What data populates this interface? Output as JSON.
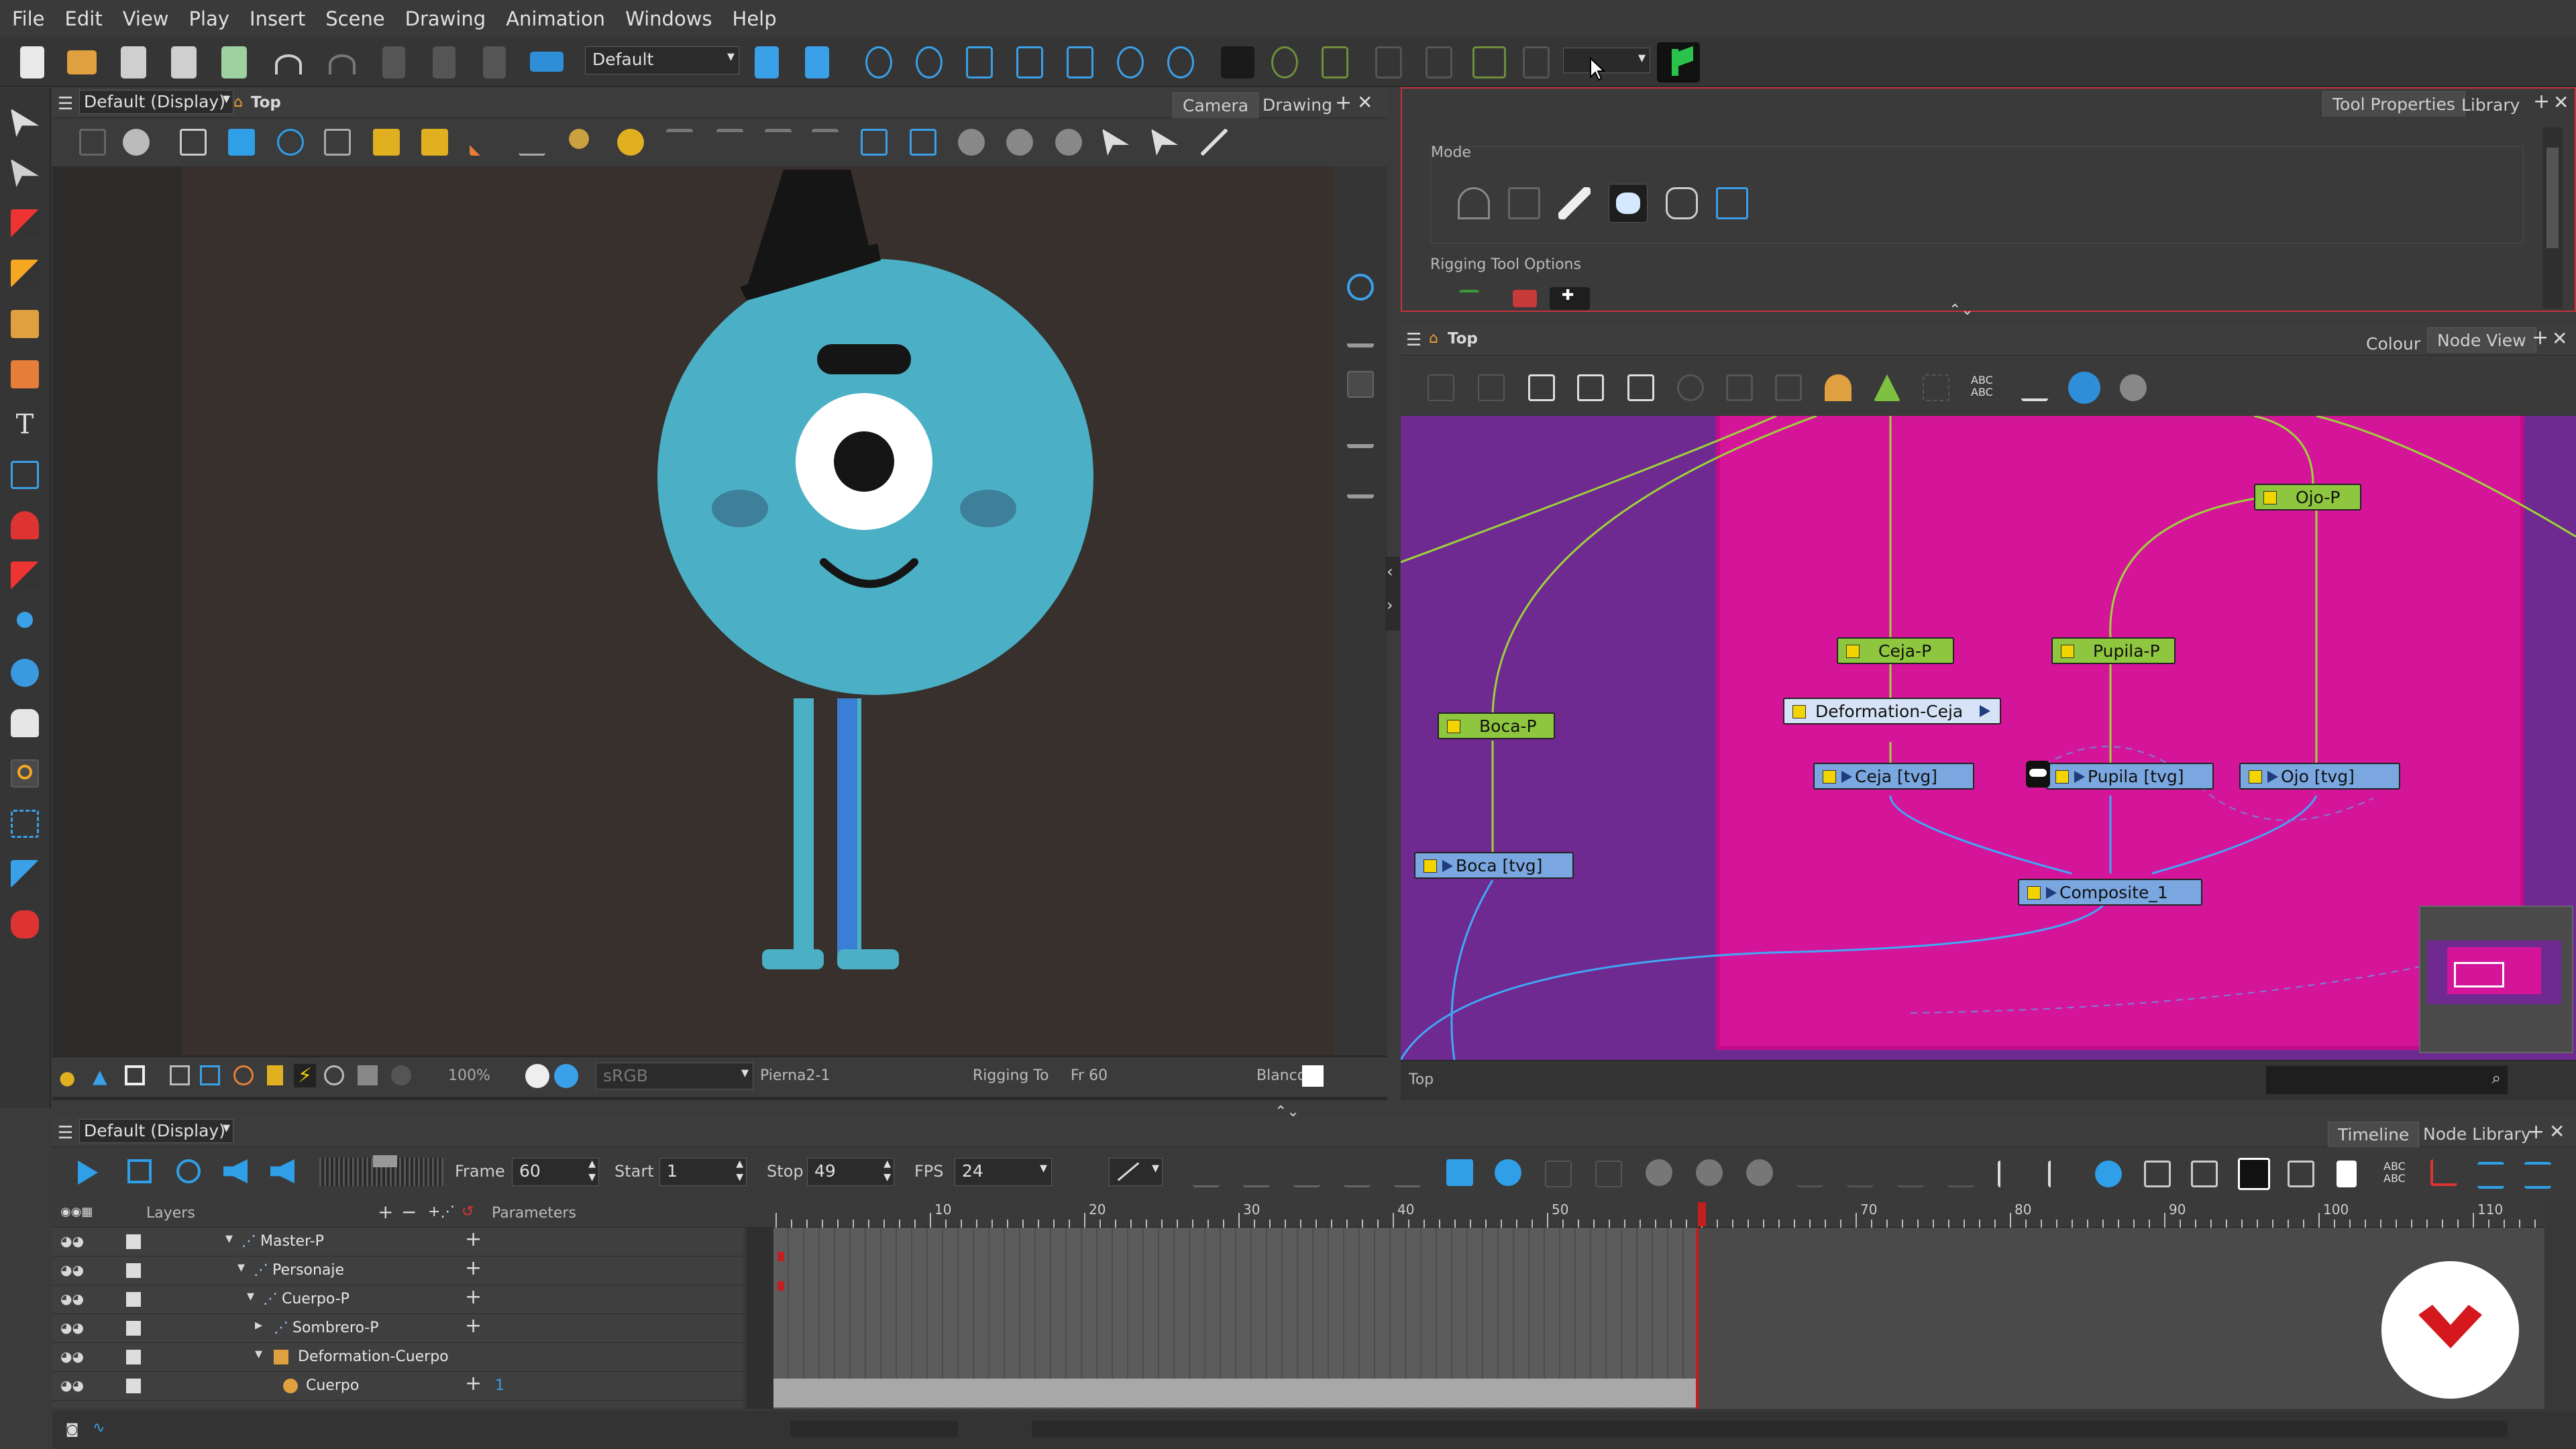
{
  "menu": [
    "File",
    "Edit",
    "View",
    "Play",
    "Insert",
    "Scene",
    "Drawing",
    "Animation",
    "Windows",
    "Help"
  ],
  "top_toolbar": {
    "workspace_value": "Default"
  },
  "camera_view": {
    "view_combo": "Default (Display)",
    "title": "Top",
    "tabs": [
      "Camera",
      "Drawing"
    ],
    "status": {
      "zoom": "100%",
      "color_space": "sRGB",
      "drawing_name": "Pierna2-1",
      "tool_name": "Rigging To",
      "frame": "Fr 60",
      "palette_color": "Blanco"
    }
  },
  "tool_properties": {
    "tabs": [
      "Tool Properties",
      "Library"
    ],
    "mode_label": "Mode",
    "rigging_options_label": "Rigging Tool Options"
  },
  "node_view": {
    "title": "Top",
    "tabs": [
      "Colour",
      "Node View"
    ],
    "footer_label": "Top",
    "nodes": {
      "ojo_p": "Ojo-P",
      "ceja_p": "Ceja-P",
      "pupila_p": "Pupila-P",
      "boca_p": "Boca-P",
      "deformation_ceja": "Deformation-Ceja",
      "ceja_tvg": "Ceja [tvg]",
      "pupila_tvg": "Pupila [tvg]",
      "ojo_tvg": "Ojo [tvg]",
      "boca_tvg": "Boca [tvg]",
      "composite": "Composite_1"
    }
  },
  "timeline": {
    "view_combo": "Default (Display)",
    "tabs": [
      "Timeline",
      "Node Library"
    ],
    "frame_label": "Frame",
    "frame_value": "60",
    "start_label": "Start",
    "start_value": "1",
    "stop_label": "Stop",
    "stop_value": "49",
    "fps_label": "FPS",
    "fps_value": "24",
    "layers_header": "Layers",
    "parameters_header": "Parameters",
    "layers": [
      {
        "name": "Master-P"
      },
      {
        "name": "Personaje"
      },
      {
        "name": "Cuerpo-P"
      },
      {
        "name": "Sombrero-P"
      },
      {
        "name": "Deformation-Cuerpo"
      },
      {
        "name": "Cuerpo",
        "param": "1"
      }
    ],
    "ruler_ticks": [
      "10",
      "20",
      "30",
      "40",
      "50",
      "70",
      "80",
      "90",
      "100",
      "110"
    ],
    "playhead_frame": 60
  },
  "colors": {
    "character": "#4bb0c6",
    "hat": "#151515",
    "leg_shade": "#3a7fd6",
    "canvas_bg": "#37302c",
    "node_view_bg": "#6f2a92",
    "backdrop": "#d4159a",
    "brand_badge": "#d4181e"
  }
}
